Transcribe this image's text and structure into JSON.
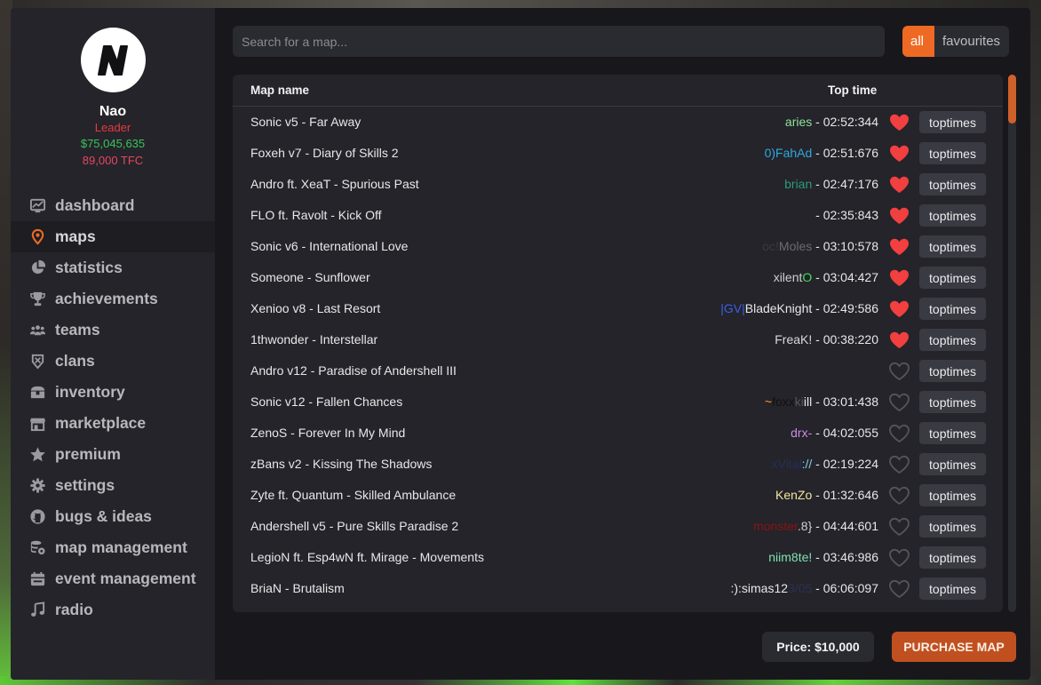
{
  "profile": {
    "initial": "N",
    "username": "Nao",
    "role": "Leader",
    "money": "$75,045,635",
    "tfc": "89,000 TFC"
  },
  "colors": {
    "accent": "#ee6a24",
    "purchase": "#c0501f",
    "heart_filled": "#f23f3f",
    "heart_empty": "#55555c",
    "money": "#3bc35a",
    "role": "#e53c3c"
  },
  "nav": [
    {
      "label": "dashboard",
      "icon": "dashboard-icon",
      "active": false
    },
    {
      "label": "maps",
      "icon": "map-pin-icon",
      "active": true
    },
    {
      "label": "statistics",
      "icon": "pie-chart-icon",
      "active": false
    },
    {
      "label": "achievements",
      "icon": "trophy-icon",
      "active": false
    },
    {
      "label": "teams",
      "icon": "users-icon",
      "active": false
    },
    {
      "label": "clans",
      "icon": "shield-icon",
      "active": false
    },
    {
      "label": "inventory",
      "icon": "chest-icon",
      "active": false
    },
    {
      "label": "marketplace",
      "icon": "store-icon",
      "active": false
    },
    {
      "label": "premium",
      "icon": "star-icon",
      "active": false
    },
    {
      "label": "settings",
      "icon": "gear-icon",
      "active": false
    },
    {
      "label": "bugs & ideas",
      "icon": "github-icon",
      "active": false
    },
    {
      "label": "map management",
      "icon": "database-gear-icon",
      "active": false
    },
    {
      "label": "event management",
      "icon": "calendar-icon",
      "active": false
    },
    {
      "label": "radio",
      "icon": "music-note-icon",
      "active": false
    }
  ],
  "search": {
    "placeholder": "Search for a map...",
    "value": ""
  },
  "filters": {
    "all": "all",
    "favourites": "favourites",
    "selected": "all"
  },
  "table": {
    "col_name": "Map name",
    "col_time": "Top time",
    "toptimes_label": "toptimes",
    "rows": [
      {
        "name": "Sonic v5 - Far Away",
        "player": [
          {
            "t": "aries",
            "c": "#8fe39a"
          }
        ],
        "time": " - 02:52:344",
        "fav": true
      },
      {
        "name": "Foxeh v7 - Diary of Skills 2",
        "player": [
          {
            "t": "0)FahAd",
            "c": "#2fa8e0"
          }
        ],
        "time": " - 02:51:676",
        "fav": true
      },
      {
        "name": "Andro ft. XeaT - Spurious Past",
        "player": [
          {
            "t": "brian",
            "c": "#2d9a7a"
          }
        ],
        "time": " - 02:47:176",
        "fav": true
      },
      {
        "name": "FLO ft. Ravolt - Kick Off",
        "player": [],
        "time": " - 02:35:843",
        "fav": true
      },
      {
        "name": "Sonic v6 - International Love",
        "player": [
          {
            "t": "oc!",
            "c": "#3a3a3e"
          },
          {
            "t": "Moles",
            "c": "#6b6b70"
          }
        ],
        "time": " - 03:10:578",
        "fav": true
      },
      {
        "name": "Someone - Sunflower",
        "player": [
          {
            "t": "xilent",
            "c": "#cfcfd3"
          },
          {
            "t": "O",
            "c": "#3ee05a"
          }
        ],
        "time": " - 03:04:427",
        "fav": true
      },
      {
        "name": "Xenioo v8 - Last Resort",
        "player": [
          {
            "t": "|GV|",
            "c": "#3d5fe6"
          },
          {
            "t": "BladeKnight",
            "c": "#e8e8ea"
          }
        ],
        "time": " - 02:49:586",
        "fav": true
      },
      {
        "name": "1thwonder - Interstellar",
        "player": [
          {
            "t": "FreaK!",
            "c": "#d9d9dc"
          }
        ],
        "time": " - 00:38:220",
        "fav": true
      },
      {
        "name": "Andro v12 - Paradise of Andershell III",
        "player": [],
        "time": "",
        "fav": false
      },
      {
        "name": "Sonic v12 - Fallen Chances",
        "player": [
          {
            "t": "~",
            "c": "#f29b24"
          },
          {
            "t": "foxx",
            "c": "#111114"
          },
          {
            "t": "ki",
            "c": "#55555a"
          },
          {
            "t": "ill",
            "c": "#e8e8ea"
          }
        ],
        "time": " - 03:01:438",
        "fav": false
      },
      {
        "name": "ZenoS - Forever In My Mind",
        "player": [
          {
            "t": "drx-",
            "c": "#c98ee6"
          }
        ],
        "time": " - 04:02:055",
        "fav": false
      },
      {
        "name": "zBans v2 - Kissing The Shadows",
        "player": [
          {
            "t": "xVital",
            "c": "#23305a"
          },
          {
            "t": "://",
            "c": "#7fd1e6"
          }
        ],
        "time": " - 02:19:224",
        "fav": false
      },
      {
        "name": "Zyte ft. Quantum - Skilled Ambulance",
        "player": [
          {
            "t": "KenZo",
            "c": "#f3e3a0"
          }
        ],
        "time": " - 01:32:646",
        "fav": false
      },
      {
        "name": "Andershell v5 - Pure Skills Paradise 2",
        "player": [
          {
            "t": "monster",
            "c": "#8a1414"
          },
          {
            "t": ".8}",
            "c": "#cfcfd3"
          }
        ],
        "time": " - 04:44:601",
        "fav": false
      },
      {
        "name": "LegioN ft. Esp4wN ft. Mirage - Movements",
        "player": [
          {
            "t": "niim8te!",
            "c": "#7fe3b0"
          }
        ],
        "time": " - 03:46:986",
        "fav": false
      },
      {
        "name": "BriaN - Brutalism",
        "player": [
          {
            "t": ":):simas12",
            "c": "#e8e8ea"
          },
          {
            "t": "3/05",
            "c": "#2a3252"
          }
        ],
        "time": " - 06:06:097",
        "fav": false
      }
    ]
  },
  "footer": {
    "price": "Price: $10,000",
    "purchase": "PURCHASE MAP"
  }
}
